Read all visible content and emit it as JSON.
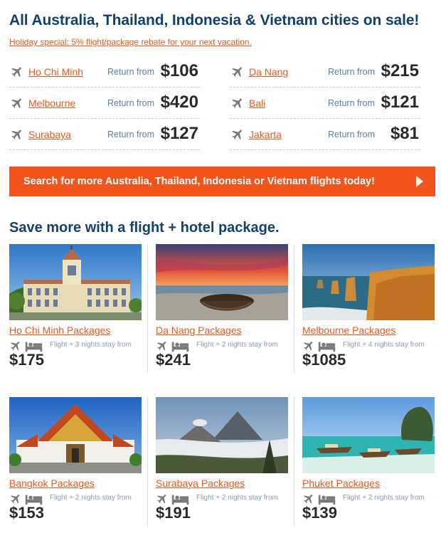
{
  "header": {
    "title": "All Australia, Thailand, Indonesia & Vietnam cities on sale!",
    "subtitle": "Holiday special: 5% flight/package rebate for your next vacation."
  },
  "deals": [
    {
      "city": "Ho Chi Minh",
      "return_label": "Return from",
      "price": "$106"
    },
    {
      "city": "Da Nang",
      "return_label": "Return from",
      "price": "$215"
    },
    {
      "city": "Melbourne",
      "return_label": "Return from",
      "price": "$420"
    },
    {
      "city": "Bali",
      "return_label": "Return from",
      "price": "$121"
    },
    {
      "city": "Surabaya",
      "return_label": "Return from",
      "price": "$127"
    },
    {
      "city": "Jakarta",
      "return_label": "Return from",
      "price": "$81"
    }
  ],
  "cta": {
    "label": "Search for more Australia, Thailand, Indonesia or Vietnam flights today!"
  },
  "packages_section": {
    "title": "Save more with a flight + hotel package."
  },
  "packages": [
    {
      "name": "Ho Chi Minh Packages",
      "stay": "Flight + 3 nights stay from",
      "price": "$175",
      "photo": "ho-chi-minh-city-hall"
    },
    {
      "name": "Da Nang Packages",
      "stay": "Flight + 2 nights stay from",
      "price": "$241",
      "photo": "da-nang-basket-boat-sunset"
    },
    {
      "name": "Melbourne Packages",
      "stay": "Flight + 4 nights stay from",
      "price": "$1085",
      "photo": "twelve-apostles-coast"
    },
    {
      "name": "Bangkok Packages",
      "stay": "Flight + 2 nights stay from",
      "price": "$153",
      "photo": "bangkok-marble-temple"
    },
    {
      "name": "Surabaya Packages",
      "stay": "Flight + 2 nights stay from",
      "price": "$191",
      "photo": "bromo-volcano"
    },
    {
      "name": "Phuket Packages",
      "stay": "Flight + 2 nights stay from",
      "price": "$139",
      "photo": "phuket-longtail-boats"
    }
  ],
  "colors": {
    "heading": "#13416d",
    "link": "#e85a20",
    "cta_bg": "#f2541c",
    "muted": "#5a7fa8"
  }
}
